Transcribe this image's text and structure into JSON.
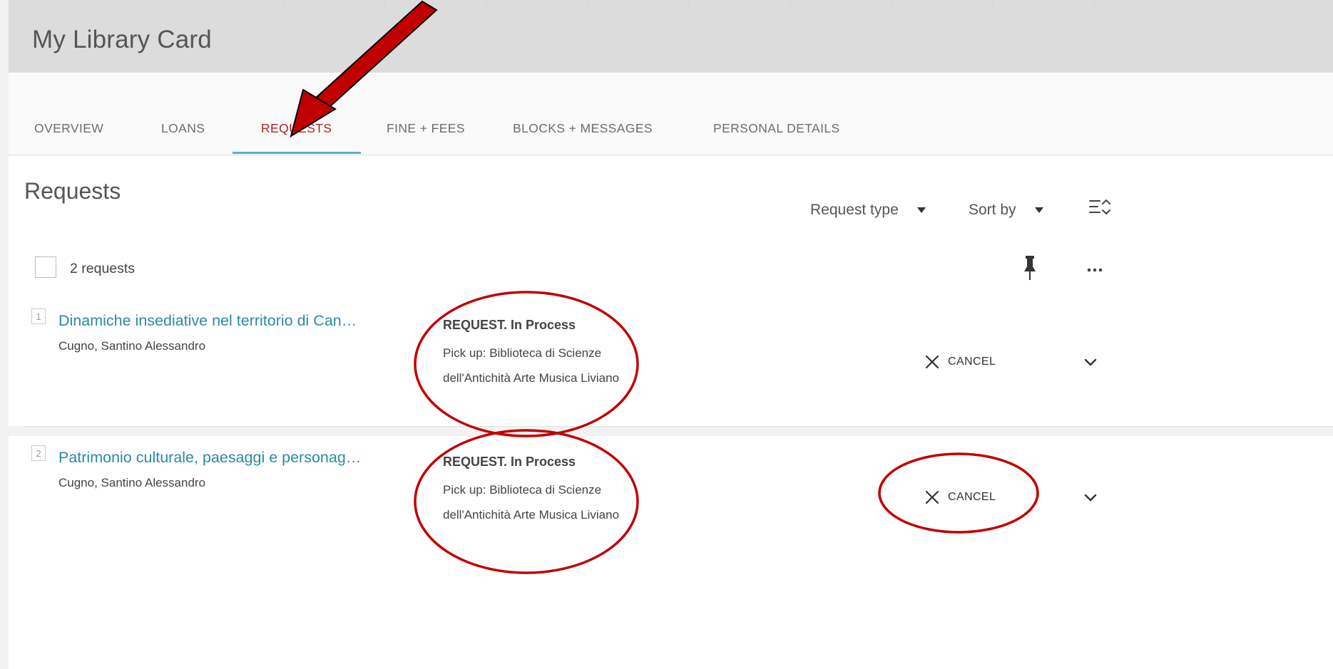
{
  "page": {
    "title": "My Library Card"
  },
  "tabs": [
    {
      "label": "OVERVIEW",
      "active": false
    },
    {
      "label": "LOANS",
      "active": false
    },
    {
      "label": "REQUESTS",
      "active": true
    },
    {
      "label": "FINE + FEES",
      "active": false
    },
    {
      "label": "BLOCKS + MESSAGES",
      "active": false
    },
    {
      "label": "PERSONAL DETAILS",
      "active": false
    }
  ],
  "requests_section": {
    "title": "Requests",
    "filters": {
      "request_type_label": "Request type",
      "sort_by_label": "Sort by"
    },
    "count_label": "2 requests",
    "items": [
      {
        "number": "1",
        "title": "Dinamiche insediative nel territorio di Can…",
        "author": "Cugno, Santino Alessandro",
        "status": "REQUEST. In Process",
        "pickup": "Pick up: Biblioteca di Scienze dell'Antichità Arte Musica Liviano",
        "cancel_label": "CANCEL"
      },
      {
        "number": "2",
        "title": "Patrimonio culturale, paesaggi e personag…",
        "author": "Cugno, Santino Alessandro",
        "status": "REQUEST. In Process",
        "pickup": "Pick up: Biblioteca di Scienze dell'Antichità Arte Musica Liviano",
        "cancel_label": "CANCEL"
      }
    ]
  },
  "icons": {
    "sort": "sort-icon",
    "pin": "pin-icon",
    "more": "more-icon",
    "cancel": "close-icon",
    "expand": "chevron-down-icon"
  },
  "colors": {
    "active_tab": "#b3202a",
    "tab_underline": "#5ab1bf",
    "link": "#2b8aa1",
    "annotation": "#c00000"
  }
}
